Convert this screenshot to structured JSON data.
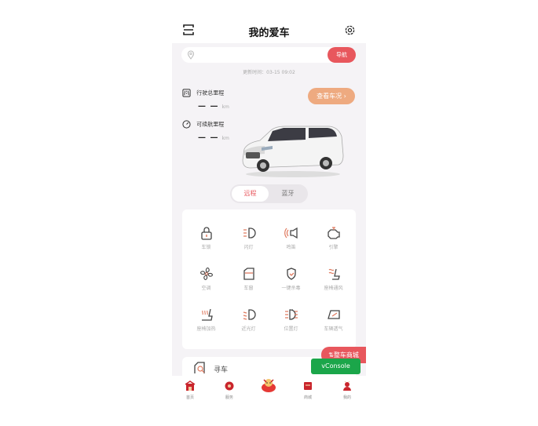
{
  "header": {
    "title": "我的爱车"
  },
  "location": {
    "address": "",
    "nav_label": "导航"
  },
  "update_time": "更新时间：03-15 09:02",
  "stats": {
    "total_mileage": {
      "label": "行驶总里程",
      "value": "— —",
      "unit": "km"
    },
    "range": {
      "label": "可续航里程",
      "value": "— —",
      "unit": "km"
    }
  },
  "view_status_label": "查看车况 ›",
  "mode_tabs": {
    "remote": "远程",
    "bluetooth": "蓝牙"
  },
  "controls": [
    {
      "label": "车锁",
      "icon": "lock-icon"
    },
    {
      "label": "闪灯",
      "icon": "flash-light-icon"
    },
    {
      "label": "鸣笛",
      "icon": "horn-icon"
    },
    {
      "label": "引擎",
      "icon": "engine-icon"
    },
    {
      "label": "空调",
      "icon": "fan-icon"
    },
    {
      "label": "车窗",
      "icon": "car-window-icon"
    },
    {
      "label": "一键杀毒",
      "icon": "shield-icon"
    },
    {
      "label": "座椅通风",
      "icon": "seat-ventilation-icon"
    },
    {
      "label": "座椅加热",
      "icon": "seat-heating-icon"
    },
    {
      "label": "近光灯",
      "icon": "low-beam-icon"
    },
    {
      "label": "位置灯",
      "icon": "position-light-icon"
    },
    {
      "label": "车辆透气",
      "icon": "car-vent-icon"
    }
  ],
  "find_car": {
    "label": "寻车"
  },
  "floating": {
    "mall": "⇅整车商城",
    "vconsole": "vConsole"
  },
  "tabbar": [
    {
      "label": "首页",
      "icon": "home-icon"
    },
    {
      "label": "服务",
      "icon": "service-icon"
    },
    {
      "label": "",
      "icon": "mascot-icon"
    },
    {
      "label": "商城",
      "icon": "mall-icon"
    },
    {
      "label": "我的",
      "icon": "profile-icon"
    }
  ],
  "colors": {
    "accent": "#e8575d",
    "orange": "#eeaa80",
    "icon": "#444444",
    "green": "#1ba64a"
  }
}
